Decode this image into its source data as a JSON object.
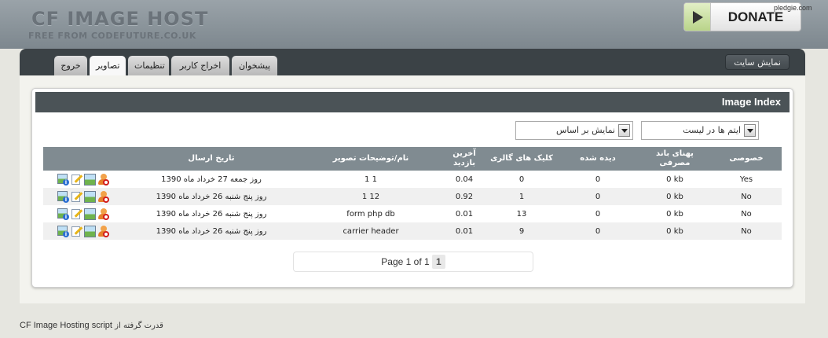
{
  "header": {
    "title": "CF IMAGE HOST",
    "subtitle": "FREE FROM CODEFUTURE.CO.UK",
    "donate_label": "DONATE",
    "watermark": "pledgie.com"
  },
  "nav": {
    "tabs": [
      {
        "label": "پیشخوان"
      },
      {
        "label": "اخراج کاربر"
      },
      {
        "label": "تنظیمات"
      },
      {
        "label": "تصاویر"
      },
      {
        "label": "خروج"
      }
    ],
    "active_tab": "تصاویر",
    "site_view": "نمایش سایت"
  },
  "panel": {
    "title": "Image Index",
    "select_items": "ایتم ها در لیست",
    "select_sort": "نمایش بر اساس"
  },
  "table": {
    "headers": [
      "خصوصی",
      "پهنای باند مصرفی",
      "دیده شده",
      "کلیک های گالری",
      "آخرین بازدید",
      "نام/توضیحات تصویر",
      "تاریخ ارسال"
    ],
    "rows": [
      {
        "private": "Yes",
        "bandwidth": "0 kb",
        "views": "0",
        "clicks": "0",
        "last": "0.04",
        "name": "1 1",
        "date": "روز جمعه 27 خرداد ماه 1390"
      },
      {
        "private": "No",
        "bandwidth": "0 kb",
        "views": "0",
        "clicks": "1",
        "last": "0.92",
        "name": "1 12",
        "date": "روز پنج شنبه 26 خرداد ماه 1390"
      },
      {
        "private": "No",
        "bandwidth": "0 kb",
        "views": "0",
        "clicks": "13",
        "last": "0.01",
        "name": "form php db",
        "date": "روز پنج شنبه 26 خرداد ماه 1390"
      },
      {
        "private": "No",
        "bandwidth": "0 kb",
        "views": "0",
        "clicks": "9",
        "last": "0.01",
        "name": "carrier header",
        "date": "روز پنج شنبه 26 خرداد ماه 1390"
      }
    ]
  },
  "pager": {
    "text": "Page 1 of 1",
    "current": "1"
  },
  "footer": {
    "prefix": "قدرت گرفته از",
    "script": "CF Image Hosting script"
  },
  "colors": {
    "navbar": "#3b4246",
    "panel_head": "#4b5357",
    "table_head": "#808b91"
  }
}
